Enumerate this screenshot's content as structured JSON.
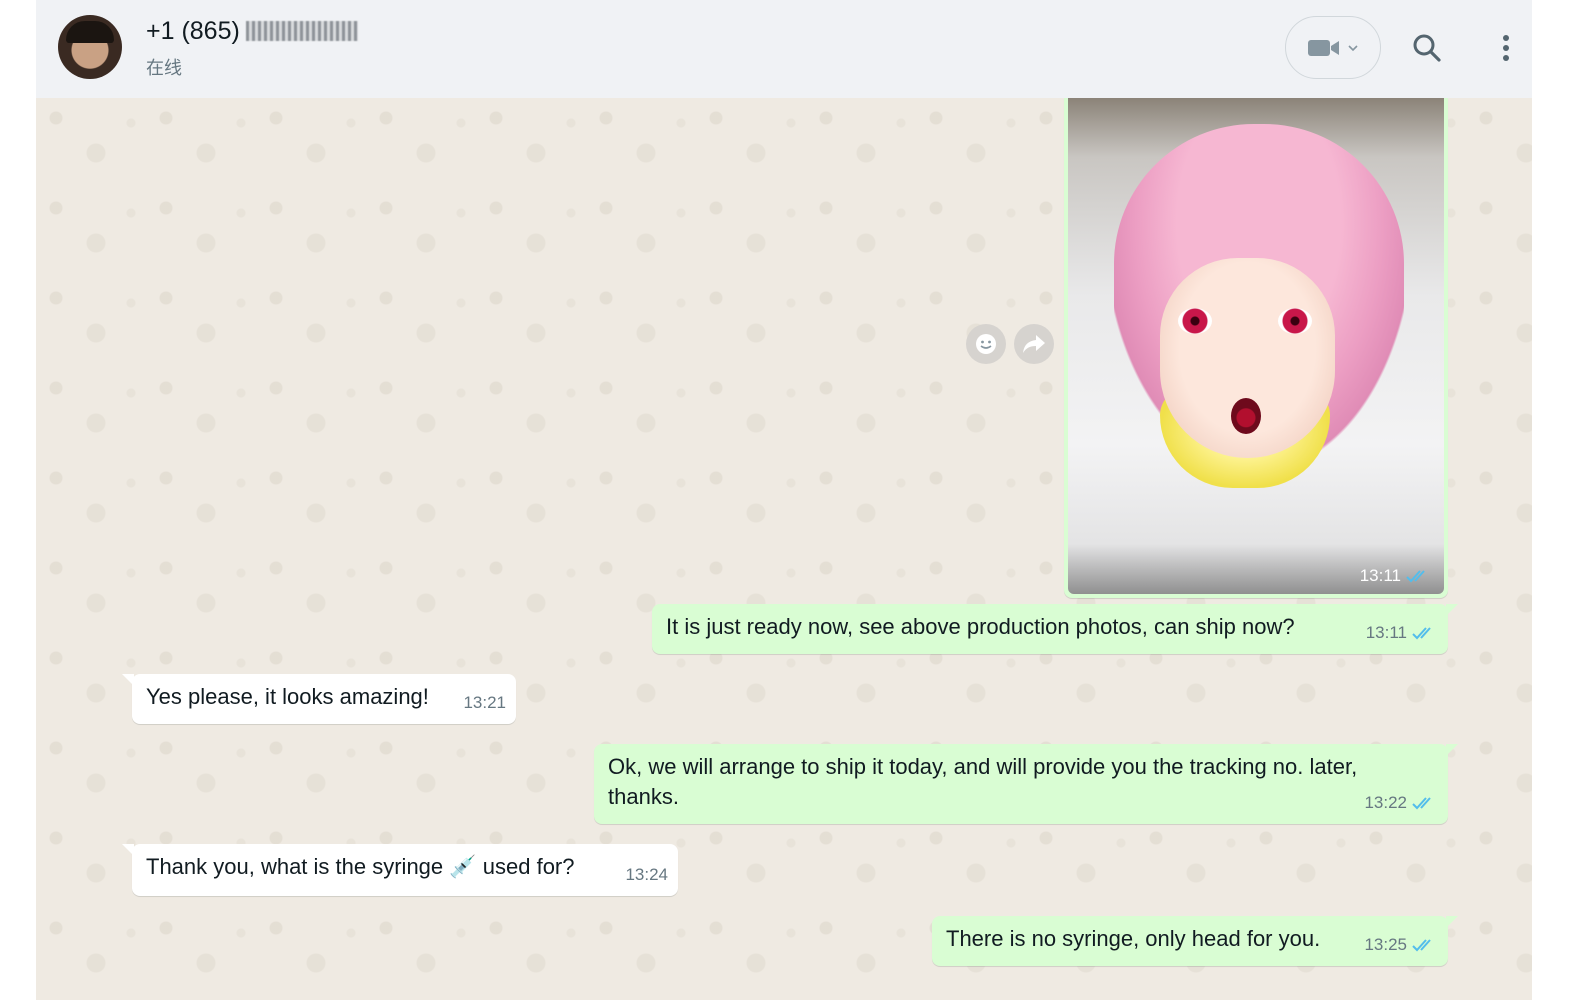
{
  "header": {
    "contact_name": "+1 (865)",
    "contact_status": "在线"
  },
  "messages": [
    {
      "type": "image",
      "time": "13:11",
      "status": "read",
      "alt": "production photo"
    },
    {
      "type": "text",
      "direction": "out",
      "text": "It is just ready now, see above production photos, can ship now?",
      "time": "13:11",
      "status": "read"
    },
    {
      "type": "text",
      "direction": "in",
      "text": "Yes please, it looks amazing!",
      "time": "13:21"
    },
    {
      "type": "text",
      "direction": "out",
      "text": "Ok, we will arrange to ship it today, and will provide you the tracking no. later, thanks.",
      "time": "13:22",
      "status": "read"
    },
    {
      "type": "text",
      "direction": "in",
      "text": "Thank you, what is the syringe 💉 used for?",
      "time": "13:24"
    },
    {
      "type": "text",
      "direction": "out",
      "text": "There is no syringe, only head for you.",
      "time": "13:25",
      "status": "read"
    }
  ],
  "icons": {
    "video": "video-camera-icon",
    "search": "search-icon",
    "menu": "kebab-menu-icon",
    "emoji_react": "emoji-reaction-icon",
    "forward": "forward-icon",
    "read_ticks": "double-check-icon"
  },
  "colors": {
    "header_bg": "#f0f2f5",
    "chat_bg": "#efeae2",
    "outgoing_bubble": "#d9fdd3",
    "incoming_bubble": "#ffffff",
    "read_tick": "#53bdeb"
  }
}
